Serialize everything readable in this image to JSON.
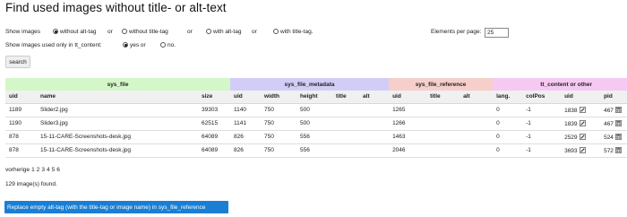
{
  "page": {
    "title": "Find used images without title- or alt-text"
  },
  "filters": {
    "show_images_label": "Show images",
    "options": [
      {
        "label": "without alt-tag",
        "checked": true
      },
      {
        "label": "without title-tag",
        "checked": false
      },
      {
        "label": "with alt-tag",
        "checked": false
      },
      {
        "label": "with title-tag.",
        "checked": false
      }
    ],
    "conjunction": "or",
    "elements_per_page_label": "Elements per page:",
    "elements_per_page_value": "25",
    "tt_content_label": "Show images used only in tt_content:",
    "tt_options": [
      {
        "label": "yes or",
        "checked": true
      },
      {
        "label": "no.",
        "checked": false
      }
    ],
    "search_label": "search"
  },
  "table": {
    "groups": [
      "sys_file",
      "sys_file_metadata",
      "sys_file_reference",
      "tt_content or other"
    ],
    "columns": [
      "uid",
      "name",
      "size",
      "uid",
      "width",
      "height",
      "title",
      "alt",
      "uid",
      "title",
      "alt",
      "lang.",
      "colPos",
      "uid",
      "pid"
    ],
    "rows": [
      [
        "1189",
        "Slider2.jpg",
        "39303",
        "1140",
        "750",
        "500",
        "",
        "",
        "1265",
        "",
        "",
        "0",
        "-1",
        "1838",
        "467"
      ],
      [
        "1190",
        "Slider3.jpg",
        "62515",
        "1141",
        "750",
        "500",
        "",
        "",
        "1266",
        "",
        "",
        "0",
        "-1",
        "1839",
        "467"
      ],
      [
        "878",
        "15-11-CARE-Screenshots-desk.jpg",
        "64089",
        "826",
        "750",
        "556",
        "",
        "",
        "1463",
        "",
        "",
        "0",
        "-1",
        "2529",
        "524"
      ],
      [
        "878",
        "15-11-CARE-Screenshots-desk.jpg",
        "64089",
        "826",
        "750",
        "556",
        "",
        "",
        "2046",
        "",
        "",
        "0",
        "-1",
        "3693",
        "572"
      ]
    ],
    "row_icons": [
      "edit-record-icon",
      "view-page-icon"
    ]
  },
  "pager": {
    "prev_label": "vorherige",
    "pages": [
      "1",
      "2",
      "3",
      "4",
      "5",
      "6"
    ]
  },
  "found_text": "129 image(s) found.",
  "replace_button_label": "Replace empty alt-tag (with the title-tag or image name) in sys_file_reference",
  "colors": {
    "sys_file": "#d4f7c9",
    "sys_file_metadata": "#d2cdf7",
    "sys_file_reference": "#f6cfcb",
    "tt_content": "#f6c9f3",
    "button_primary": "#1a7fd4"
  }
}
